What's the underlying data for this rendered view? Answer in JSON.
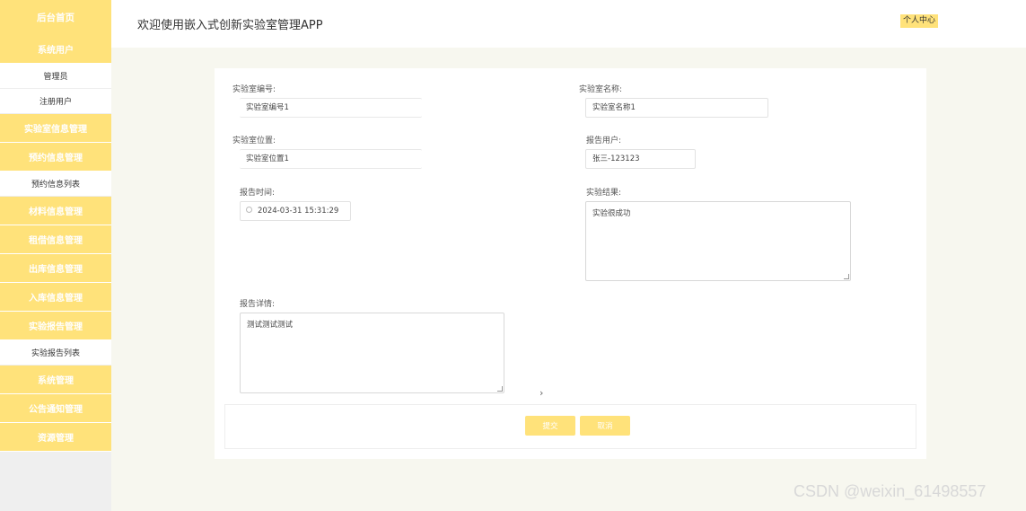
{
  "sidebar": {
    "header": "后台首页",
    "menu": [
      {
        "label": "系统用户",
        "type": "main"
      },
      {
        "label": "管理员",
        "type": "sub"
      },
      {
        "label": "注册用户",
        "type": "sub"
      },
      {
        "label": "实验室信息管理",
        "type": "main"
      },
      {
        "label": "预约信息管理",
        "type": "main"
      },
      {
        "label": "预约信息列表",
        "type": "sub"
      },
      {
        "label": "材料信息管理",
        "type": "main"
      },
      {
        "label": "租借信息管理",
        "type": "main"
      },
      {
        "label": "出库信息管理",
        "type": "main"
      },
      {
        "label": "入库信息管理",
        "type": "main"
      },
      {
        "label": "实验报告管理",
        "type": "main"
      },
      {
        "label": "实验报告列表",
        "type": "sub"
      },
      {
        "label": "系统管理",
        "type": "main"
      },
      {
        "label": "公告通知管理",
        "type": "main"
      },
      {
        "label": "资源管理",
        "type": "main"
      }
    ]
  },
  "topbar": {
    "welcome": "欢迎使用嵌入式创新实验室管理APP",
    "user_center": "个人中心"
  },
  "form": {
    "lab_no_label": "实验室编号:",
    "lab_no_value": "实验室编号1",
    "lab_name_label": "实验室名称:",
    "lab_name_value": "实验室名称1",
    "lab_location_label": "实验室位置:",
    "lab_location_value": "实验室位置1",
    "report_user_label": "报告用户:",
    "report_user_value": "张三-123123",
    "report_time_label": "报告时间:",
    "report_time_value": "2024-03-31 15:31:29",
    "result_label": "实验结果:",
    "result_value": "实验很成功",
    "detail_label": "报告详情:",
    "detail_value": "测试测试测试",
    "submit_label": "提交",
    "cancel_label": "取消"
  },
  "watermark": "CSDN @weixin_61498557",
  "colors": {
    "accent": "#ffe27a",
    "background": "#f7f7ef"
  }
}
